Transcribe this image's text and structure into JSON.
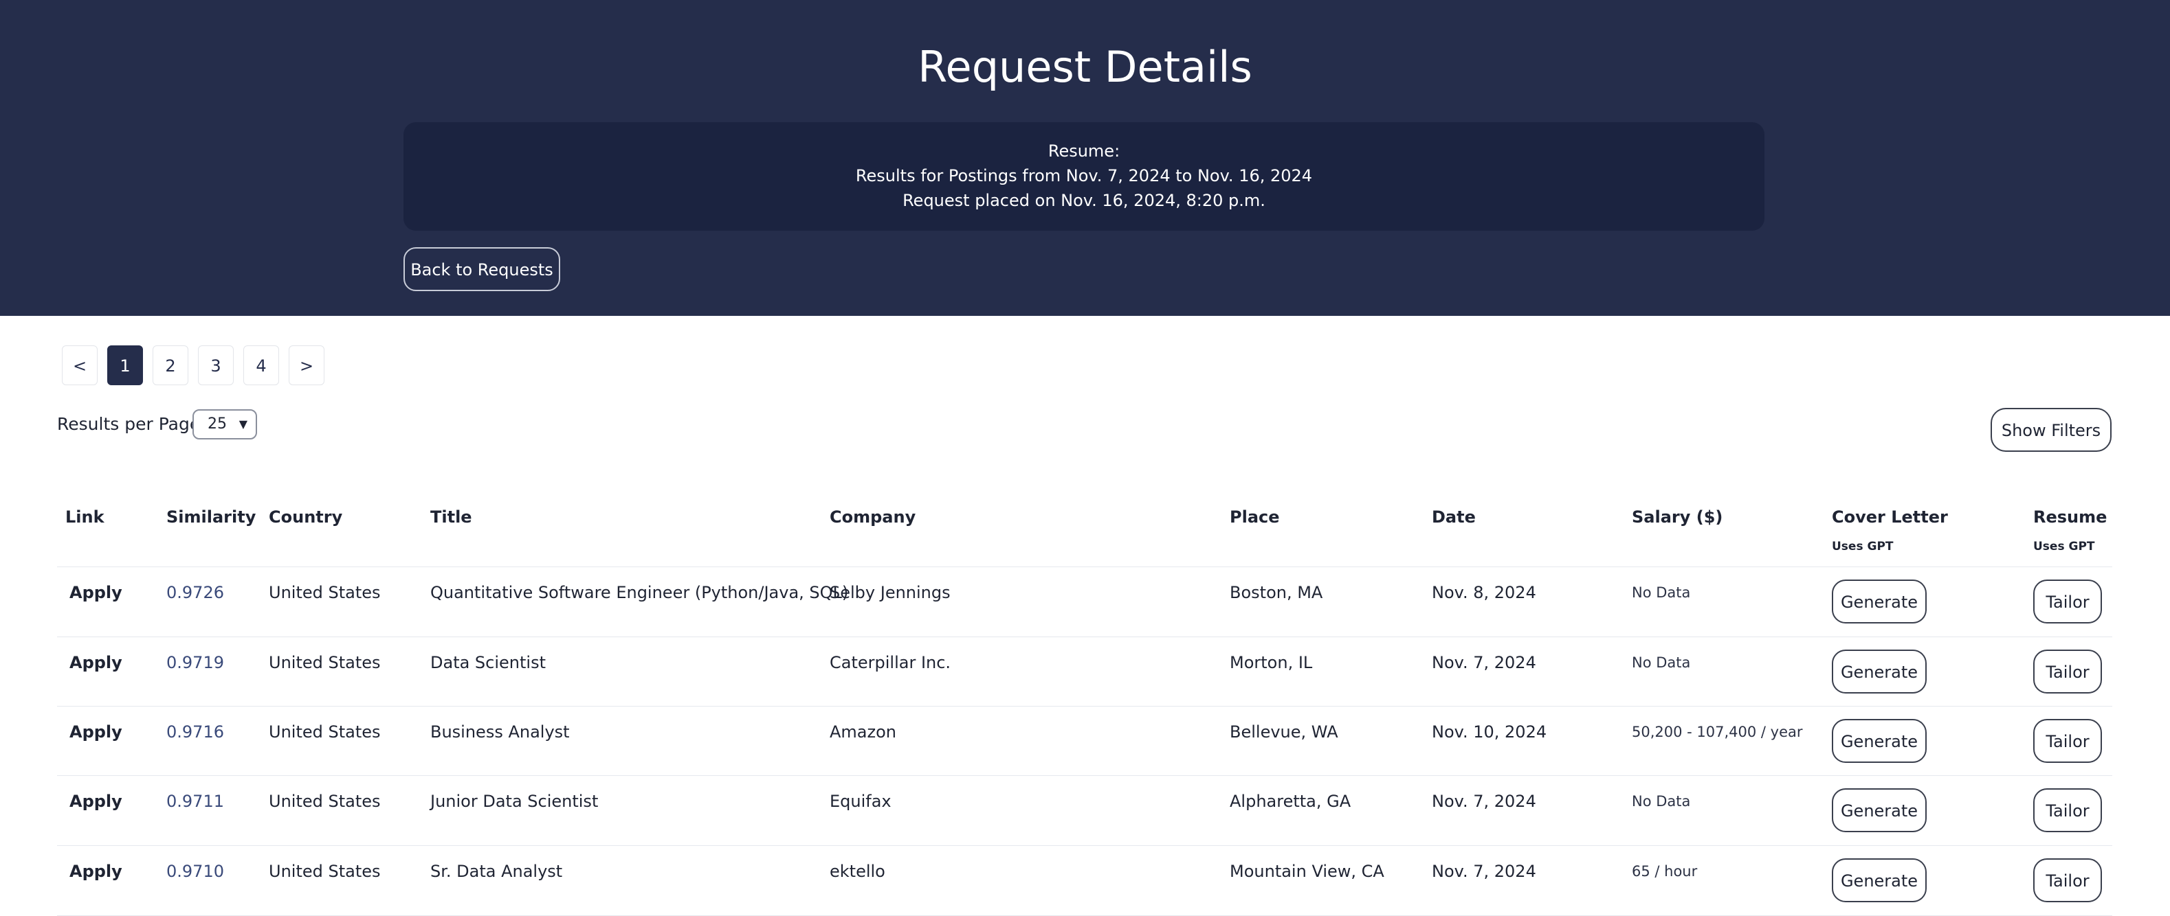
{
  "header": {
    "title": "Request Details",
    "resume_label": "Resume:",
    "range_text": "Results for Postings from Nov. 7, 2024 to Nov. 16, 2024",
    "placed_text": "Request placed on Nov. 16, 2024, 8:20 p.m.",
    "back_label": "Back to Requests"
  },
  "pagination": {
    "prev": "<",
    "next": ">",
    "pages": [
      "1",
      "2",
      "3",
      "4"
    ],
    "current": "1"
  },
  "controls": {
    "results_per_page_label": "Results per Page",
    "results_per_page_value": "25",
    "show_filters_label": "Show Filters"
  },
  "table": {
    "headers": {
      "link": "Link",
      "similarity": "Similarity",
      "country": "Country",
      "title": "Title",
      "company": "Company",
      "place": "Place",
      "date": "Date",
      "salary": "Salary ($)",
      "cover_letter": "Cover Letter",
      "cover_letter_sub": "Uses GPT",
      "resume": "Resume",
      "resume_sub": "Uses GPT"
    },
    "rows": [
      {
        "link": "Apply",
        "similarity": "0.9726",
        "country": "United States",
        "title": "Quantitative Software Engineer (Python/Java, SQL)",
        "company": "Selby Jennings",
        "place": "Boston, MA",
        "date": "Nov. 8, 2024",
        "salary": "No Data",
        "cover": "Generate",
        "resume": "Tailor"
      },
      {
        "link": "Apply",
        "similarity": "0.9719",
        "country": "United States",
        "title": "Data Scientist",
        "company": "Caterpillar Inc.",
        "place": "Morton, IL",
        "date": "Nov. 7, 2024",
        "salary": "No Data",
        "cover": "Generate",
        "resume": "Tailor"
      },
      {
        "link": "Apply",
        "similarity": "0.9716",
        "country": "United States",
        "title": "Business Analyst",
        "company": "Amazon",
        "place": "Bellevue, WA",
        "date": "Nov. 10, 2024",
        "salary": "50,200 - 107,400 / year",
        "cover": "Generate",
        "resume": "Tailor"
      },
      {
        "link": "Apply",
        "similarity": "0.9711",
        "country": "United States",
        "title": "Junior Data Scientist",
        "company": "Equifax",
        "place": "Alpharetta, GA",
        "date": "Nov. 7, 2024",
        "salary": "No Data",
        "cover": "Generate",
        "resume": "Tailor"
      },
      {
        "link": "Apply",
        "similarity": "0.9710",
        "country": "United States",
        "title": "Sr. Data Analyst",
        "company": "ektello",
        "place": "Mountain View, CA",
        "date": "Nov. 7, 2024",
        "salary": "65 / hour",
        "cover": "Generate",
        "resume": "Tailor"
      }
    ]
  },
  "colors": {
    "header_bg": "#252d4b",
    "card_bg": "#1b2340",
    "accent": "#252d4b",
    "similarity": "#3a4a7a"
  }
}
